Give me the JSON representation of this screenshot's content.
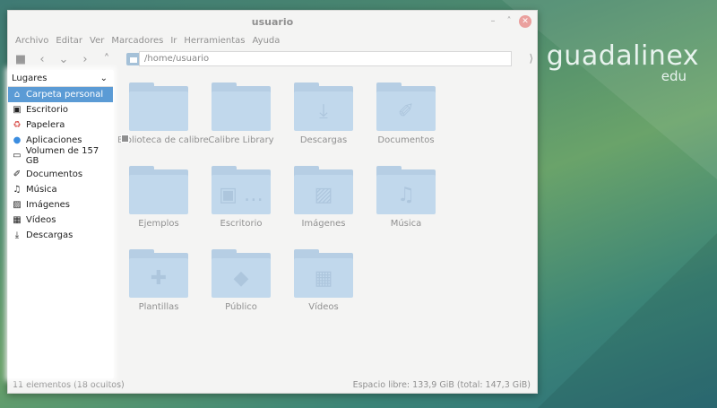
{
  "desktop": {
    "logo_main": "guadalinex",
    "logo_sub": "edu"
  },
  "window": {
    "title": "usuario",
    "controls": {
      "minimize": "–",
      "maximize": "˄",
      "close": "✕"
    }
  },
  "menubar": [
    "Archivo",
    "Editar",
    "Ver",
    "Marcadores",
    "Ir",
    "Herramientas",
    "Ayuda"
  ],
  "toolbar": {
    "address": "/home/usuario",
    "buttons": {
      "places": "■",
      "back": "‹",
      "forward_menu": "⌄",
      "forward": "›",
      "up": "˄",
      "go": "⟩"
    }
  },
  "sidebar": {
    "header": "Lugares",
    "header_icon": "⌄",
    "group1": [
      {
        "label": "Carpeta personal",
        "icon": "home-icon",
        "glyph": "⌂",
        "selected": true
      },
      {
        "label": "Escritorio",
        "icon": "desktop-icon",
        "glyph": "▣"
      },
      {
        "label": "Papelera",
        "icon": "trash-icon",
        "glyph": "♻"
      },
      {
        "label": "Aplicaciones",
        "icon": "applications-icon",
        "glyph": "●"
      },
      {
        "label": "Volumen de 157 GB",
        "icon": "drive-icon",
        "glyph": "▭"
      }
    ],
    "group2": [
      {
        "label": "Documentos",
        "icon": "paperclip-icon",
        "glyph": "✐"
      },
      {
        "label": "Música",
        "icon": "music-icon",
        "glyph": "♫"
      },
      {
        "label": "Imágenes",
        "icon": "image-icon",
        "glyph": "▨"
      },
      {
        "label": "Vídeos",
        "icon": "video-icon",
        "glyph": "▦"
      },
      {
        "label": "Descargas",
        "icon": "download-icon",
        "glyph": "⤓"
      }
    ]
  },
  "files": [
    {
      "label": "Biblioteca de calibre",
      "icon": "folder-icon",
      "glyph": ""
    },
    {
      "label": "Calibre Library",
      "icon": "folder-icon",
      "glyph": ""
    },
    {
      "label": "Descargas",
      "icon": "download-folder-icon",
      "glyph": "⤓"
    },
    {
      "label": "Documentos",
      "icon": "documents-folder-icon",
      "glyph": "✐"
    },
    {
      "label": "Ejemplos",
      "icon": "folder-link-icon",
      "glyph": ""
    },
    {
      "label": "Escritorio",
      "icon": "desktop-folder-icon",
      "glyph": "▣ …"
    },
    {
      "label": "Imágenes",
      "icon": "pictures-folder-icon",
      "glyph": "▨"
    },
    {
      "label": "Música",
      "icon": "music-folder-icon",
      "glyph": "♫"
    },
    {
      "label": "Plantillas",
      "icon": "templates-folder-icon",
      "glyph": "✚"
    },
    {
      "label": "Público",
      "icon": "public-folder-icon",
      "glyph": "◆"
    },
    {
      "label": "Vídeos",
      "icon": "videos-folder-icon",
      "glyph": "▦"
    }
  ],
  "status": {
    "left": "11 elementos (18 ocultos)",
    "right": "Espacio libre: 133,9 GiB (total: 147,3 GiB)"
  }
}
